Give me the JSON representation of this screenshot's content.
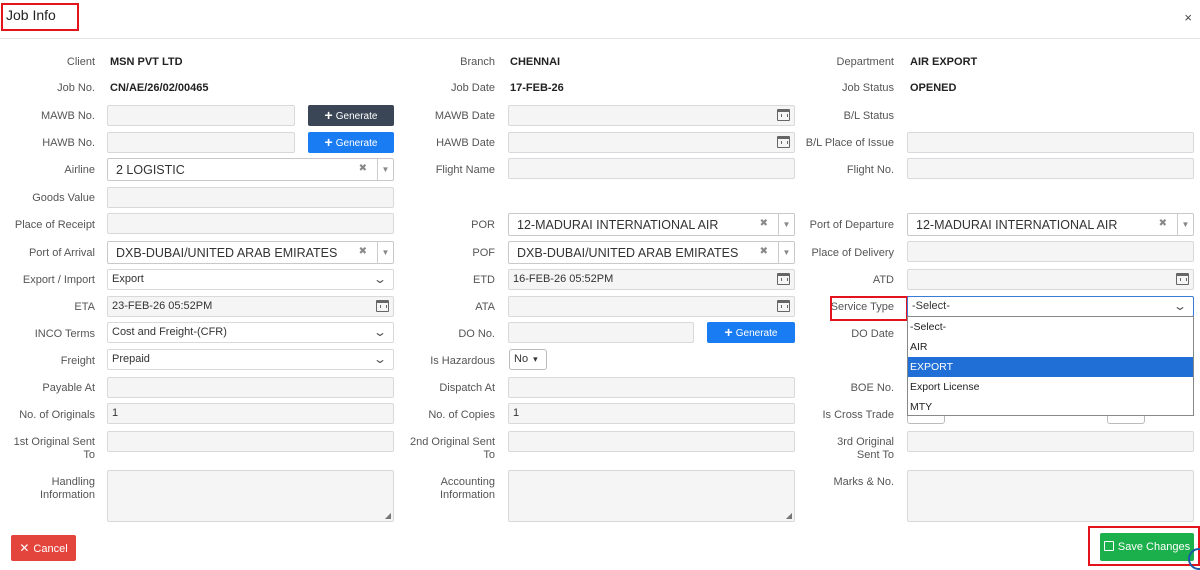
{
  "header": {
    "title": "Job Info",
    "close_symbol": "×"
  },
  "col1": {
    "client_label": "Client",
    "client_value": "MSN PVT LTD",
    "jobno_label": "Job No.",
    "jobno_value": "CN/AE/26/02/00465",
    "mawbno_label": "MAWB No.",
    "mawbno_value": "",
    "hawbno_label": "HAWB No.",
    "hawbno_value": "",
    "airline_label": "Airline",
    "airline_value": "2 LOGISTIC",
    "goods_label": "Goods Value",
    "goods_value": "",
    "receipt_label": "Place of Receipt",
    "receipt_value": "",
    "arrival_label": "Port of Arrival",
    "arrival_value": "DXB-DUBAI/UNITED ARAB EMIRATES",
    "expimp_label": "Export / Import",
    "expimp_value": "Export",
    "eta_label": "ETA",
    "eta_value": "23-FEB-26 05:52PM",
    "inco_label": "INCO Terms",
    "inco_value": "Cost and Freight-(CFR)",
    "freight_label": "Freight",
    "freight_value": "Prepaid",
    "payable_label": "Payable At",
    "payable_value": "",
    "originals_label": "No. of Originals",
    "originals_value": "1",
    "first_sent_label": "1st Original Sent To",
    "first_sent_value": "",
    "handling_label": "Handling Information"
  },
  "col2": {
    "branch_label": "Branch",
    "branch_value": "CHENNAI",
    "jobdate_label": "Job Date",
    "jobdate_value": "17-FEB-26",
    "mawbdate_label": "MAWB Date",
    "hawbdate_label": "HAWB Date",
    "flightname_label": "Flight Name",
    "por_label": "POR",
    "por_value": "12-MADURAI INTERNATIONAL AIR",
    "pof_label": "POF",
    "pof_value": "DXB-DUBAI/UNITED ARAB EMIRATES",
    "etd_label": "ETD",
    "etd_value": "16-FEB-26 05:52PM",
    "ata_label": "ATA",
    "ata_value": "",
    "dono_label": "DO No.",
    "dono_value": "",
    "hazardous_label": "Is Hazardous",
    "hazardous_value": "No",
    "dispatch_label": "Dispatch At",
    "dispatch_value": "",
    "copies_label": "No. of Copies",
    "copies_value": "1",
    "second_sent_label": "2nd Original Sent To",
    "accounting_label": "Accounting Information"
  },
  "col3": {
    "dept_label": "Department",
    "dept_value": "AIR EXPORT",
    "status_label": "Job Status",
    "status_value": "OPENED",
    "bl_status_label": "B/L Status",
    "bl_place_label": "B/L Place of Issue",
    "flightno_label": "Flight No.",
    "departure_label": "Port of Departure",
    "departure_value": "12-MADURAI INTERNATIONAL AIR",
    "delivery_label": "Place of Delivery",
    "atd_label": "ATD",
    "service_label": "Service Type",
    "service_value": "-Select-",
    "dodate_label": "DO Date",
    "boe_label": "BOE No.",
    "crosstrade_label": "Is Cross Trade",
    "third_sent_label": "3rd Original Sent To",
    "marks_label": "Marks & No."
  },
  "buttons": {
    "generate": "Generate",
    "cancel": "Cancel",
    "save": "Save Changes"
  },
  "service_options": [
    "-Select-",
    "AIR",
    "EXPORT",
    "Export License",
    "MTY"
  ],
  "service_highlighted": "EXPORT",
  "colors": {
    "red_highlight": "#e3131b",
    "dark_button": "#3a4656",
    "blue_button": "#1a7cf3",
    "cancel_red": "#e3453c",
    "save_green": "#1bb04b",
    "selected_option": "#1f6fd6"
  }
}
